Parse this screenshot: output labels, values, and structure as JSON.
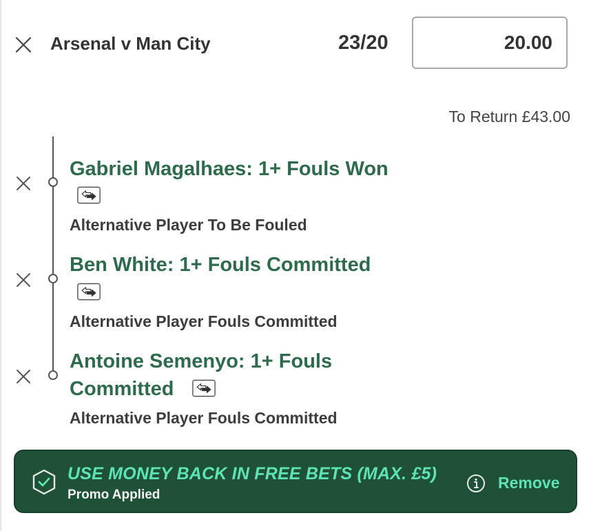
{
  "bet": {
    "match": "Arsenal v Man City",
    "odds": "23/20",
    "stake": "20.00",
    "to_return": "To Return £43.00"
  },
  "legs": [
    {
      "title": "Gabriel Magalhaes: 1+ Fouls Won",
      "market": "Alternative Player To Be Fouled"
    },
    {
      "title": "Ben White: 1+ Fouls Committed",
      "market": "Alternative Player Fouls Committed"
    },
    {
      "title_line1": "Antoine Semenyo: 1+ Fouls",
      "title_line2": "Committed",
      "market": "Alternative Player Fouls Committed"
    }
  ],
  "promo": {
    "title": "USE MONEY BACK IN FREE BETS (MAX. £5)",
    "status": "Promo Applied",
    "remove_label": "Remove"
  },
  "icons": {
    "close": "close-icon",
    "swap": "swap-selection-icon",
    "shield": "shield-check-icon",
    "info": "info-icon"
  },
  "colors": {
    "selection_green": "#2e6b4c",
    "promo_bg": "#1e5137",
    "promo_accent": "#5fe3b4"
  }
}
